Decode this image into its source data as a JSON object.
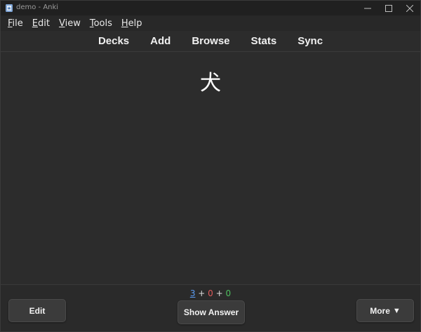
{
  "window": {
    "title": "demo - Anki"
  },
  "menu": [
    "File",
    "Edit",
    "View",
    "Tools",
    "Help"
  ],
  "toolbar": {
    "links": [
      "Decks",
      "Add",
      "Browse",
      "Stats",
      "Sync"
    ]
  },
  "card": {
    "front": "犬"
  },
  "counts": {
    "new": "3",
    "learning": "0",
    "review": "0",
    "separator": "+"
  },
  "buttons": {
    "edit": "Edit",
    "show_answer": "Show Answer",
    "more": "More",
    "more_arrow": "▼"
  },
  "colors": {
    "new": "#5b9bf0",
    "learning": "#e05b5b",
    "review": "#4fbf5f"
  },
  "icons": {
    "app": "anki-app-icon",
    "minimize": "minimize-icon",
    "maximize": "maximize-icon",
    "close": "close-icon"
  }
}
